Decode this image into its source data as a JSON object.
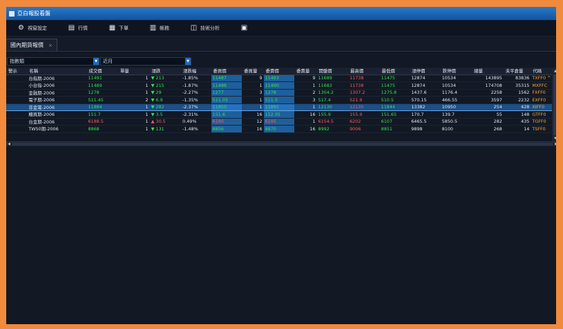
{
  "window": {
    "title": "亞白報股看盤"
  },
  "toolbar": [
    {
      "label": "視窗設定",
      "icon": "settings-icon"
    },
    {
      "label": "行情",
      "icon": "quote-icon"
    },
    {
      "label": "下單",
      "icon": "order-icon"
    },
    {
      "label": "帳務",
      "icon": "account-icon"
    },
    {
      "label": "技術分析",
      "icon": "chart-analysis-icon"
    },
    {
      "label": "",
      "icon": "grid-icon"
    }
  ],
  "doc_tab": {
    "label": "國內期貨報價",
    "close": "×"
  },
  "filters": {
    "group": "指數類",
    "month": "近月"
  },
  "table": {
    "headers": [
      "警示",
      "名稱",
      "成交價",
      "單量",
      "漲跌",
      "漲跌幅",
      "委買價",
      "委買量",
      "委賣價",
      "委賣量",
      "開盤價",
      "最高價",
      "最低價",
      "漲停價",
      "跌停價",
      "總量",
      "未平倉量",
      "代碼"
    ],
    "rows": [
      {
        "name": "台指期-2006",
        "price": "11491",
        "vol": "1",
        "chg": "▼ 213",
        "pct": "-1.85%",
        "bid": "11487",
        "bidq": "9",
        "ask": "11493",
        "askq": "9",
        "open": "11689",
        "high": "11738",
        "low": "11475",
        "lim_up": "12874",
        "lim_dn": "10534",
        "total": "143895",
        "oi": "83836",
        "code": "TXFF0 ^",
        "dir": "dn"
      },
      {
        "name": "小台指-2006",
        "price": "11489",
        "vol": "1",
        "chg": "▼ 215",
        "pct": "-1.87%",
        "bid": "11488",
        "bidq": "1",
        "ask": "11490",
        "askq": "1",
        "open": "11683",
        "high": "11738",
        "low": "11475",
        "lim_up": "12874",
        "lim_dn": "10534",
        "total": "174708",
        "oi": "35315",
        "code": "MXFFC",
        "dir": "dn"
      },
      {
        "name": "金融期-2006",
        "price": "1278",
        "vol": "1",
        "chg": "▼ 29",
        "pct": "-2.27%",
        "bid": "1277",
        "bidq": "3",
        "ask": "1278",
        "askq": "2",
        "open": "1304.2",
        "high": "1307.2",
        "low": "1275.8",
        "lim_up": "1437.6",
        "lim_dn": "1176.4",
        "total": "2258",
        "oi": "1562",
        "code": "FXFF0",
        "dir": "dn"
      },
      {
        "name": "電子期-2006",
        "price": "511.45",
        "vol": "2",
        "chg": "▼ 6.9",
        "pct": "-1.35%",
        "bid": "511.05",
        "bidq": "1",
        "ask": "511.5",
        "askq": "3",
        "open": "517.4",
        "high": "521.9",
        "low": "510.5",
        "lim_up": "570.15",
        "lim_dn": "466.55",
        "total": "3597",
        "oi": "2232",
        "code": "EXFF0",
        "dir": "dn"
      },
      {
        "name": "非金電-2006",
        "price": "11884",
        "vol": "1",
        "chg": "▼ 282",
        "pct": "-2.37%",
        "bid": "11850",
        "bidq": "1",
        "ask": "11891",
        "askq": "1",
        "open": "12130",
        "high": "12135",
        "low": "11844",
        "lim_up": "13382",
        "lim_dn": "10950",
        "total": "254",
        "oi": "428",
        "code": "XIFF0",
        "dir": "dn",
        "selected": true
      },
      {
        "name": "櫃買期-2006",
        "price": "151.7",
        "vol": "1",
        "chg": "▼ 3.5",
        "pct": "-2.31%",
        "bid": "151.6",
        "bidq": "16",
        "ask": "152.05",
        "askq": "16",
        "open": "155.9",
        "high": "155.9",
        "low": "151.65",
        "lim_up": "170.7",
        "lim_dn": "139.7",
        "total": "55",
        "oi": "148",
        "code": "GTFF0",
        "dir": "dn"
      },
      {
        "name": "台金期-2006",
        "price": "6188.5",
        "vol": "1",
        "chg": "▲ 30.5",
        "pct": "0.49%",
        "bid": "6190",
        "bidq": "12",
        "ask": "6195",
        "askq": "1",
        "open": "6154.5",
        "high": "6202",
        "low": "6107",
        "lim_up": "6465.5",
        "lim_dn": "5850.5",
        "total": "282",
        "oi": "435",
        "code": "TGFF0",
        "dir": "up"
      },
      {
        "name": "TW50期-2006",
        "price": "8868",
        "vol": "1",
        "chg": "▼ 131",
        "pct": "-1.48%",
        "bid": "8856",
        "bidq": "16",
        "ask": "8870",
        "askq": "16",
        "open": "8992",
        "high": "9006",
        "low": "8851",
        "lim_up": "9898",
        "lim_dn": "8100",
        "total": "268",
        "oi": "14",
        "code": "TSFF0",
        "dir": "dn"
      }
    ]
  },
  "colors": {
    "up": "#ff5b5b",
    "down": "#34e34e",
    "highlight": "#1e5f9c",
    "title_bar": "#1a64b3"
  }
}
